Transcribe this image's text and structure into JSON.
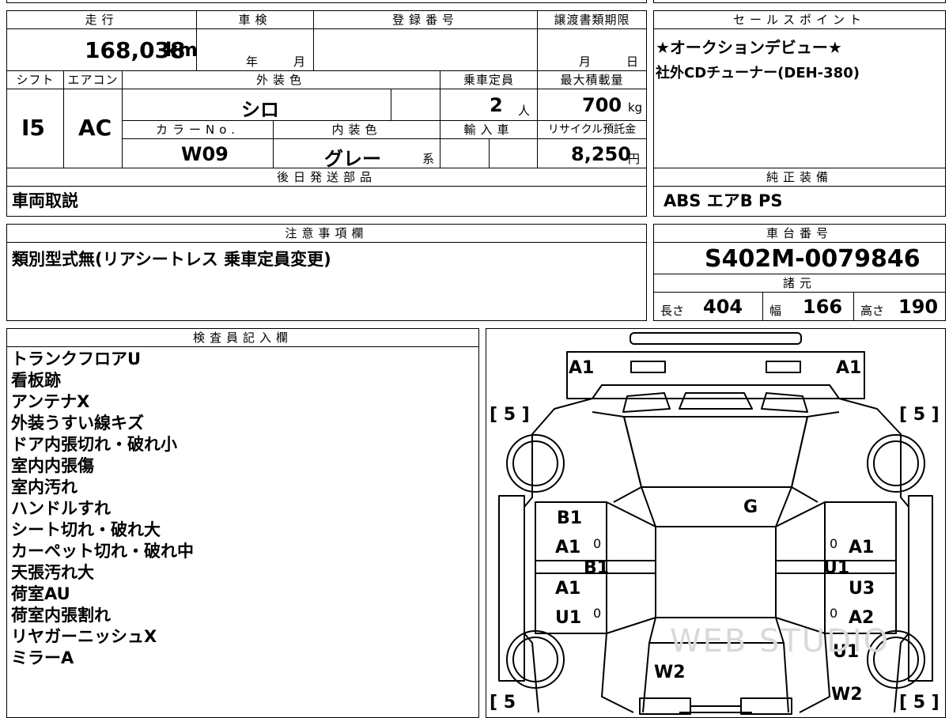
{
  "top": {
    "mileage_header": "走行",
    "mileage": "168,038",
    "mileage_unit": "km",
    "inspection_header": "車検",
    "inspection_year_label": "年",
    "inspection_month_label": "月",
    "registration_header": "登録番号",
    "registration_value": "",
    "transfer_header": "譲渡書類期限",
    "transfer_month_label": "月",
    "transfer_day_label": "日"
  },
  "row2": {
    "shift_header": "シフト",
    "shift": "I5",
    "aircon_header": "エアコン",
    "aircon": "AC",
    "exterior_color_header": "外装色",
    "exterior_color": "シロ",
    "capacity_header": "乗車定員",
    "capacity": "2",
    "capacity_unit": "人",
    "max_load_header": "最大積載量",
    "max_load": "700",
    "max_load_unit": "kg",
    "color_no_header": "カラーNo.",
    "color_no": "W09",
    "interior_color_header": "内装色",
    "interior_color": "グレー",
    "interior_suffix": "系",
    "import_header": "輸入車",
    "recycle_header": "リサイクル預託金",
    "recycle_fee": "8,250",
    "recycle_unit": "円"
  },
  "later_parts": {
    "header": "後日発送部品",
    "value": "車両取説"
  },
  "sales_point": {
    "header": "セールスポイント",
    "lines": [
      "★オークションデビュー★",
      "社外CDチューナー(DEH-380)"
    ]
  },
  "genuine_equipment": {
    "header": "純正装備",
    "value": "ABS エアB PS"
  },
  "notes": {
    "header": "注意事項欄",
    "value": "類別型式無(リアシートレス 乗車定員変更)"
  },
  "chassis": {
    "header": "車台番号",
    "value": "S402M-0079846"
  },
  "specs": {
    "header": "諸元",
    "length_label": "長さ",
    "length": "404",
    "width_label": "幅",
    "width": "166",
    "height_label": "高さ",
    "height": "190"
  },
  "inspector": {
    "header": "検査員記入欄",
    "items": [
      "トランクフロアU",
      "看板跡",
      "アンテナX",
      "外装うすい線キズ",
      "ドア内張切れ・破れ小",
      "室内内張傷",
      "室内汚れ",
      "ハンドルすれ",
      "シート切れ・破れ大",
      "カーペット切れ・破れ中",
      "天張汚れ大",
      "荷室AU",
      "荷室内張割れ",
      "リヤガーニッシュX",
      "ミラーA"
    ]
  },
  "diagram": {
    "rear_left": "A1",
    "rear_right": "A1",
    "tire_tl": "[ 5 ]",
    "tire_tr": "[ 5 ]",
    "tire_bl": "[ 5",
    "tire_br": "[ 5 ]",
    "roof": "G",
    "left_b1": "B1",
    "left_a1_upper": "A1",
    "left_b1_pillar": "B1",
    "left_a1_lower": "A1",
    "left_u1": "U1",
    "left_zero_upper": "0",
    "left_zero_lower": "0",
    "right_a1": "A1",
    "right_u1_pillar": "U1",
    "right_u3": "U3",
    "right_a2": "A2",
    "right_zero_upper": "0",
    "right_zero_lower": "0",
    "right_u1_lower": "U1",
    "hood_w2": "W2",
    "right_w2": "W2",
    "watermark": "WEB STUDIO"
  }
}
